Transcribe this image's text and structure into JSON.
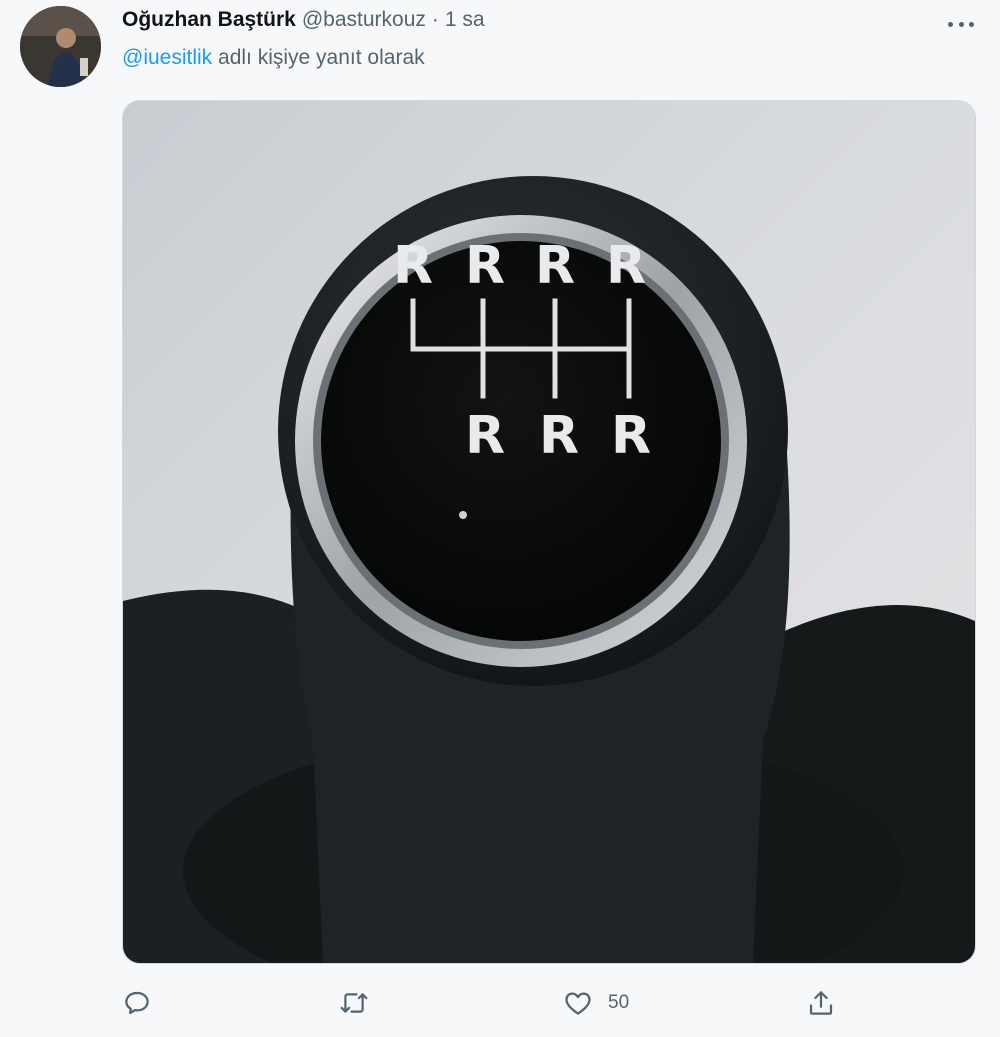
{
  "tweet": {
    "author_name": "Oğuzhan Baştürk",
    "author_handle": "@basturkouz",
    "separator": "·",
    "time": "1 sa",
    "reply_mention": "@iuesitlik",
    "reply_text": " adlı kişiye yanıt olarak"
  },
  "media": {
    "gear_labels_top": [
      "R",
      "R",
      "R",
      "R"
    ],
    "gear_labels_bottom": [
      "R",
      "R",
      "R"
    ]
  },
  "actions": {
    "reply_icon": "comment-icon",
    "retweet_icon": "retweet-icon",
    "like_icon": "heart-icon",
    "like_count": "50",
    "share_icon": "share-icon"
  },
  "colors": {
    "accent": "#1d9bf0",
    "secondary_text": "#536471",
    "primary_text": "#0f1419"
  }
}
